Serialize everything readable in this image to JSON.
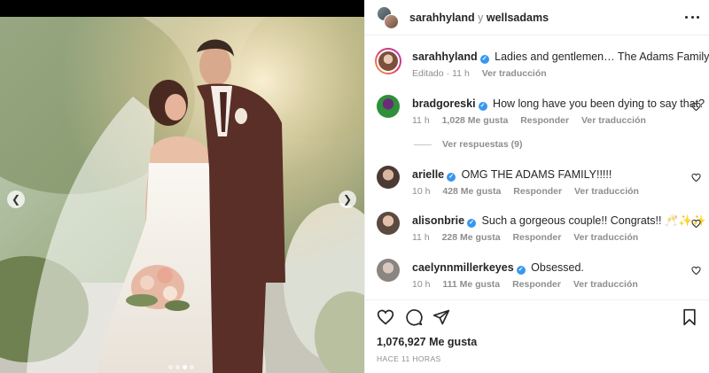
{
  "post": {
    "photo": {
      "slide_count": 4,
      "active_slide": 3
    },
    "header": {
      "user1": "sarahhyland",
      "joiner": "y",
      "user2": "wellsadams"
    },
    "caption": {
      "username": "sarahhyland",
      "text": "Ladies and gentlemen… The Adams Family ✨🌙",
      "edited": "Editado",
      "separator": "·",
      "time": "11 h",
      "translate": "Ver traducción"
    },
    "comments": [
      {
        "username": "bradgoreski",
        "text": "How long have you been dying to say that?",
        "time": "11 h",
        "likes": "1,028 Me gusta",
        "reply": "Responder",
        "translate": "Ver traducción",
        "replies_label": "Ver respuestas (9)"
      },
      {
        "username": "arielle",
        "text": "OMG THE ADAMS FAMILY!!!!!",
        "time": "10 h",
        "likes": "428 Me gusta",
        "reply": "Responder",
        "translate": "Ver traducción"
      },
      {
        "username": "alisonbrie",
        "text": "Such a gorgeous couple!! Congrats!! 🥂✨✨",
        "time": "11 h",
        "likes": "228 Me gusta",
        "reply": "Responder",
        "translate": "Ver traducción"
      },
      {
        "username": "caelynnmillerkeyes",
        "text": "Obsessed.",
        "time": "10 h",
        "likes": "111 Me gusta",
        "reply": "Responder",
        "translate": "Ver traducción"
      }
    ],
    "likes_total": "1,076,927 Me gusta",
    "posted_ago": "HACE 11 HORAS"
  },
  "colors": {
    "verified": "#3897f0",
    "muted": "#8e8e8e",
    "text": "#262626"
  },
  "icons": {
    "actions": [
      "heart-icon",
      "comment-icon",
      "share-icon",
      "bookmark-icon"
    ],
    "more": "more-options-icon"
  }
}
